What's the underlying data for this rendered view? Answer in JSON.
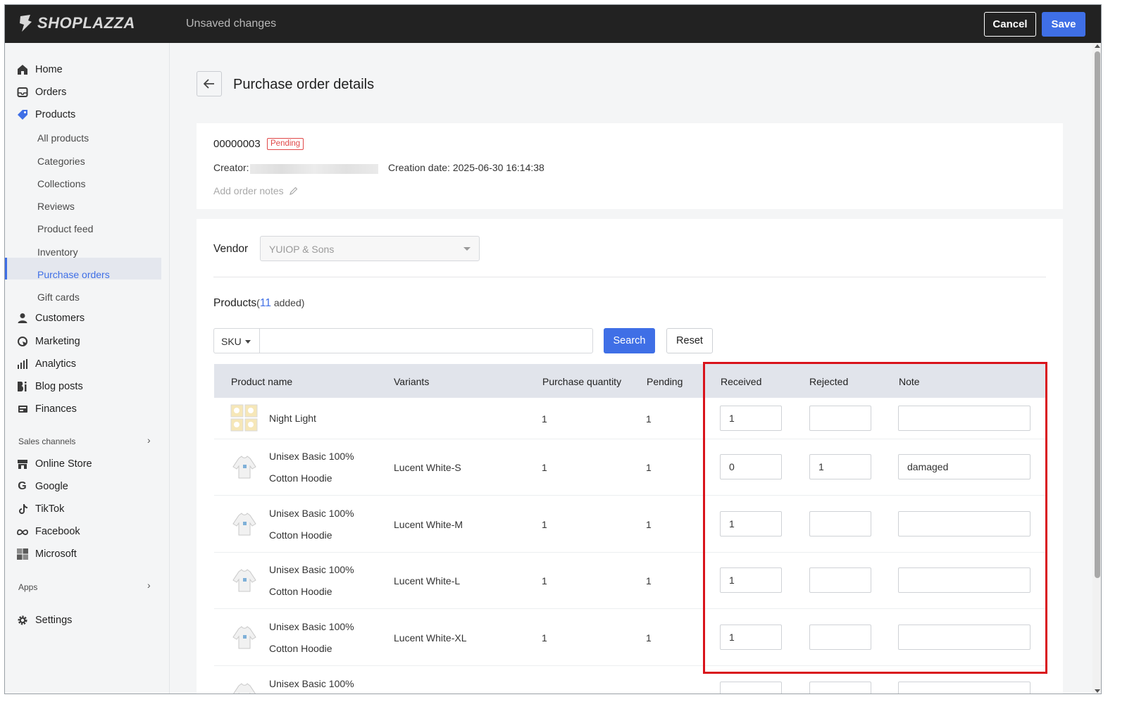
{
  "topbar": {
    "logo_text": "SHOPLAZZA",
    "status": "Unsaved changes",
    "cancel_label": "Cancel",
    "save_label": "Save"
  },
  "sidebar": {
    "items": [
      {
        "label": "Home",
        "icon": "home-icon"
      },
      {
        "label": "Orders",
        "icon": "inbox-icon"
      },
      {
        "label": "Products",
        "icon": "tag-icon"
      },
      {
        "label": "Customers",
        "icon": "person-icon"
      },
      {
        "label": "Marketing",
        "icon": "marketing-icon"
      },
      {
        "label": "Analytics",
        "icon": "bar-chart-icon"
      },
      {
        "label": "Blog posts",
        "icon": "blog-icon"
      },
      {
        "label": "Finances",
        "icon": "finance-icon"
      }
    ],
    "product_sub": [
      "All products",
      "Categories",
      "Collections",
      "Reviews",
      "Product feed",
      "Inventory",
      "Purchase orders",
      "Gift cards"
    ],
    "active_sub": "Purchase orders",
    "sales_channels_label": "Sales channels",
    "channels": [
      {
        "label": "Online Store",
        "icon": "store-icon"
      },
      {
        "label": "Google",
        "icon": "google-icon"
      },
      {
        "label": "TikTok",
        "icon": "tiktok-icon"
      },
      {
        "label": "Facebook",
        "icon": "meta-icon"
      },
      {
        "label": "Microsoft",
        "icon": "microsoft-icon"
      }
    ],
    "apps_label": "Apps",
    "settings_label": "Settings"
  },
  "page": {
    "title": "Purchase order details",
    "order_number": "00000003",
    "status_badge": "Pending",
    "creator_label": "Creator:",
    "creation_date": "Creation date: 2025-06-30 16:14:38",
    "add_notes": "Add order notes",
    "vendor_label": "Vendor",
    "vendor_value": "YUIOP & Sons",
    "products_label": "Products",
    "products_count_open": "(",
    "products_count": "11",
    "products_added": " added)",
    "sku_select": "SKU",
    "search_label": "Search",
    "reset_label": "Reset"
  },
  "table": {
    "headers": {
      "product_name": "Product name",
      "variants": "Variants",
      "purchase_quantity": "Purchase quantity",
      "pending": "Pending",
      "received": "Received",
      "rejected": "Rejected",
      "note": "Note"
    },
    "rows": [
      {
        "name1": "Night Light",
        "name2": "",
        "variant": "",
        "qty": "1",
        "pending": "1",
        "received": "1",
        "rejected": "",
        "note": ""
      },
      {
        "name1": "Unisex Basic 100%",
        "name2": "Cotton Hoodie",
        "variant": "Lucent White-S",
        "qty": "1",
        "pending": "1",
        "received": "0",
        "rejected": "1",
        "note": "damaged"
      },
      {
        "name1": "Unisex Basic 100%",
        "name2": "Cotton Hoodie",
        "variant": "Lucent White-M",
        "qty": "1",
        "pending": "1",
        "received": "1",
        "rejected": "",
        "note": ""
      },
      {
        "name1": "Unisex Basic 100%",
        "name2": "Cotton Hoodie",
        "variant": "Lucent White-L",
        "qty": "1",
        "pending": "1",
        "received": "1",
        "rejected": "",
        "note": ""
      },
      {
        "name1": "Unisex Basic 100%",
        "name2": "Cotton Hoodie",
        "variant": "Lucent White-XL",
        "qty": "1",
        "pending": "1",
        "received": "1",
        "rejected": "",
        "note": ""
      },
      {
        "name1": "Unisex Basic 100%",
        "name2": "",
        "variant": "",
        "qty": "",
        "pending": "",
        "received": "",
        "rejected": "",
        "note": ""
      }
    ]
  },
  "colors": {
    "accent": "#3f6fe6",
    "topbar": "#222222",
    "highlight": "#d9131b",
    "badge": "#e04848"
  }
}
